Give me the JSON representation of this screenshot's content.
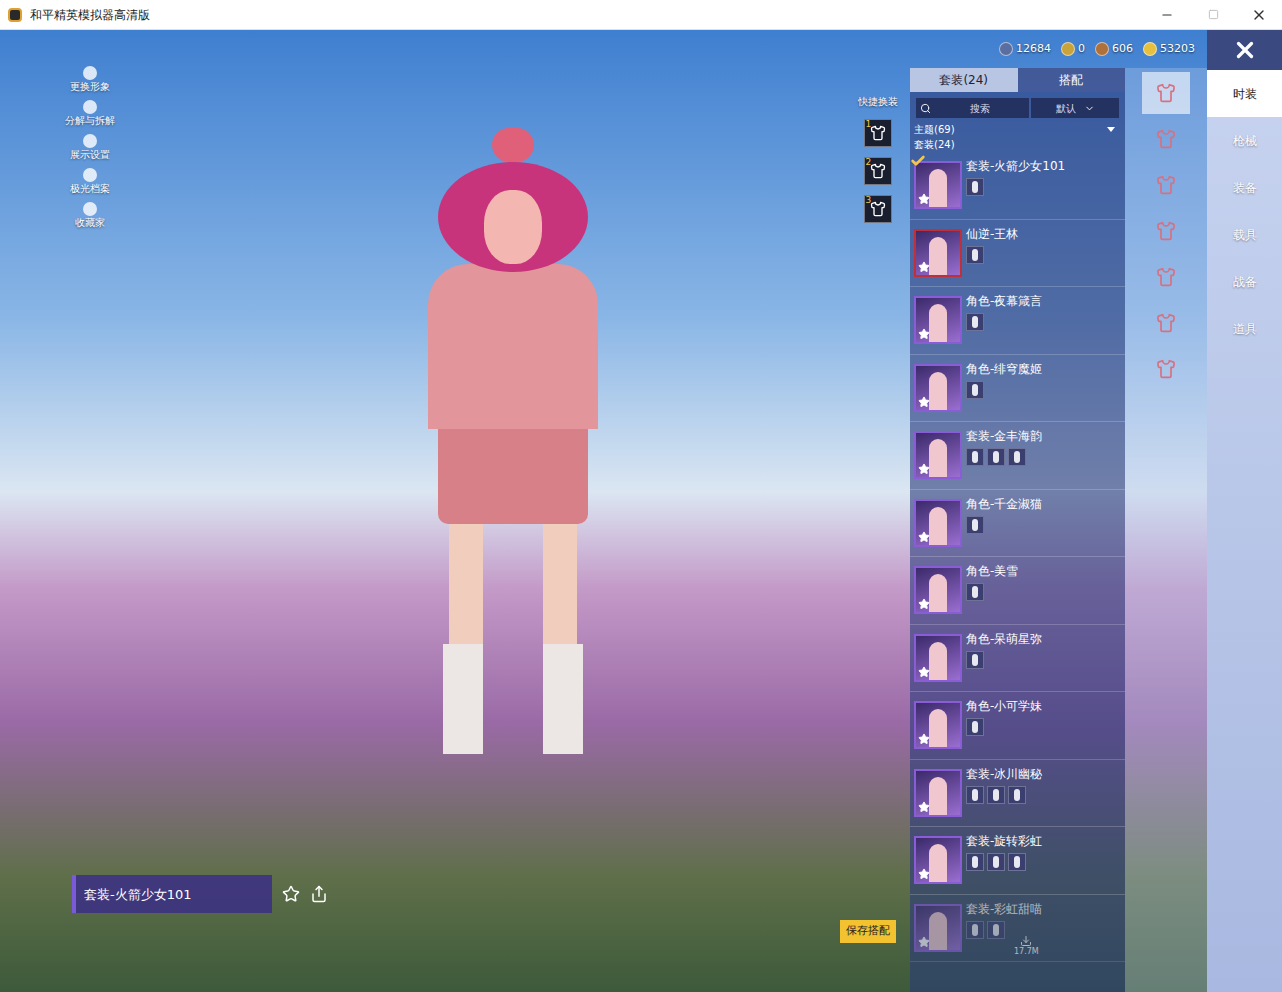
{
  "window": {
    "title": "和平精英模拟器高清版"
  },
  "left_menu": [
    {
      "label": "更换形象"
    },
    {
      "label": "分解与拆解"
    },
    {
      "label": "展示设置"
    },
    {
      "label": "极光档案"
    },
    {
      "label": "收藏家"
    }
  ],
  "currencies": [
    {
      "amount": "12684",
      "color": "#5a6fa0"
    },
    {
      "amount": "0",
      "color": "#c9a43a"
    },
    {
      "amount": "606",
      "color": "#b0703a"
    },
    {
      "amount": "53203",
      "color": "#e8c040"
    }
  ],
  "category_icons": [
    {
      "selected": true
    },
    {
      "selected": false
    },
    {
      "selected": false
    },
    {
      "selected": false
    },
    {
      "selected": false
    },
    {
      "selected": false
    },
    {
      "selected": false
    }
  ],
  "category_tabs": [
    {
      "label": "时装",
      "selected": true
    },
    {
      "label": "枪械",
      "selected": false
    },
    {
      "label": "装备",
      "selected": false
    },
    {
      "label": "载具",
      "selected": false
    },
    {
      "label": "战备",
      "selected": false
    },
    {
      "label": "道具",
      "selected": false
    }
  ],
  "quick_change": {
    "label": "快捷换装",
    "slots": [
      {
        "number": "1"
      },
      {
        "number": "2"
      },
      {
        "number": "3"
      }
    ]
  },
  "panel": {
    "tabs": [
      {
        "label": "套装(24)",
        "selected": true
      },
      {
        "label": "搭配",
        "selected": false
      }
    ],
    "search": {
      "placeholder": "搜索"
    },
    "sort": {
      "value": "默认"
    },
    "group_header": "主题(69)",
    "section": "套装(24)",
    "items": [
      {
        "name": "套装-火箭少女101",
        "selected": true,
        "disabled": false,
        "parts": 1,
        "color": "#8a5cd6"
      },
      {
        "name": "仙逆-王林",
        "selected": false,
        "disabled": false,
        "parts": 1,
        "color": "#c0303a"
      },
      {
        "name": "角色-夜幕箴言",
        "selected": false,
        "disabled": false,
        "parts": 1,
        "color": "#8a5cd6"
      },
      {
        "name": "角色-绯穹魔姬",
        "selected": false,
        "disabled": false,
        "parts": 1,
        "color": "#8a5cd6"
      },
      {
        "name": "套装-金丰海韵",
        "selected": false,
        "disabled": false,
        "parts": 3,
        "color": "#8a5cd6"
      },
      {
        "name": "角色-千金淑猫",
        "selected": false,
        "disabled": false,
        "parts": 1,
        "color": "#8a5cd6"
      },
      {
        "name": "角色-美雪",
        "selected": false,
        "disabled": false,
        "parts": 1,
        "color": "#8a5cd6"
      },
      {
        "name": "角色-呆萌星弥",
        "selected": false,
        "disabled": false,
        "parts": 1,
        "color": "#8a5cd6"
      },
      {
        "name": "角色-小可学妹",
        "selected": false,
        "disabled": false,
        "parts": 1,
        "color": "#8a5cd6"
      },
      {
        "name": "套装-冰川幽秘",
        "selected": false,
        "disabled": false,
        "parts": 3,
        "color": "#8a5cd6"
      },
      {
        "name": "套装-旋转彩虹",
        "selected": false,
        "disabled": false,
        "parts": 3,
        "color": "#8a5cd6"
      },
      {
        "name": "套装-彩虹甜喵",
        "selected": false,
        "disabled": true,
        "parts": 2,
        "color": "#8a5cd6",
        "download": "17.7M"
      }
    ]
  },
  "preview_label": "套装-火箭少女101",
  "save_button": "保存搭配"
}
